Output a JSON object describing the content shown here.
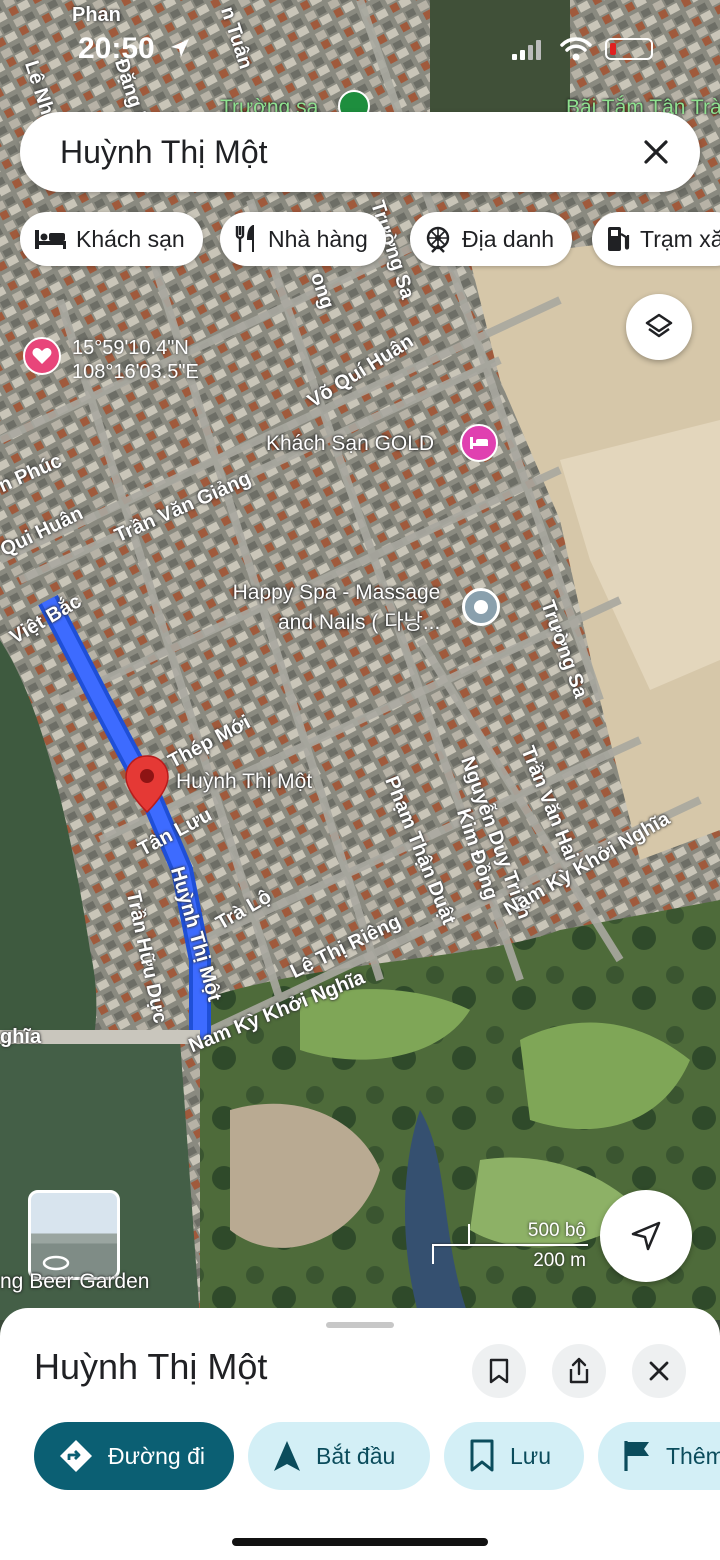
{
  "status_bar": {
    "time": "20:50"
  },
  "search": {
    "query": "Huỳnh Thị Một"
  },
  "chips": [
    {
      "label": "Khách sạn",
      "icon": "bed-icon"
    },
    {
      "label": "Nhà hàng",
      "icon": "restaurant-icon"
    },
    {
      "label": "Địa danh",
      "icon": "landmark-icon"
    },
    {
      "label": "Trạm xă",
      "icon": "gas-station-icon"
    }
  ],
  "map": {
    "coordinates": {
      "lat": "15°59'10.4\"N",
      "lng": "108°16'03.5\"E"
    },
    "pin_label": "Huỳnh Thị Một",
    "pois": {
      "hotel": "Khách Sạn GOLD",
      "spa_line1": "Happy Spa - Massage",
      "spa_line2": "and Nails ( 다낭...",
      "beer_garden": "ng Beer Garden",
      "top_poi": "Trường sa",
      "top_right_poi": "Bãi Tắm Tân Trà"
    },
    "roads": {
      "le_nhu_ho": "Lê Như Hổ",
      "phan": "Phan",
      "dang_hai": "Đặng Hải",
      "tuan": "n Tuân",
      "truong_sa_1": "Trường Sa",
      "ong": "ong",
      "vo_qui_huan_1": "Võ Quí Huân",
      "phuc": "n Phúc",
      "qui_huan": "Qui Huân",
      "tran_van_giang": "Trần Văn Giảng",
      "viet_bac": "Việt Bắc",
      "thep_moi": "Thép Mới",
      "tan_luu": "Tân Lưu",
      "huynh_thi_mot": "Huỳnh Thị Một",
      "tran_huu_duc": "Trần Hữu Dực",
      "tra_lo": "Trà Lộ",
      "le_thi_rieng": "Lê Thị Riêng",
      "nam_ky_khoi_nghia_1": "Nam Kỳ Khởi Nghĩa",
      "nam_ky_khoi_nghia_2": "Nam Kỳ Khởi Nghĩa",
      "nghia": "ghĩa",
      "pham_than_duat": "Phạm Thận Duật",
      "kim_dong": "Kim Đồng",
      "nguyen_duy_trinh": "Nguyễn Duy Trinh",
      "tran_van_hai": "Trần Văn Hai",
      "truong_sa_2": "Trường Sa",
      "nam_ky_right": "Nam Kỳ Khởi Nghĩa"
    },
    "scale": {
      "imperial": "500 bộ",
      "metric": "200 m"
    }
  },
  "sheet": {
    "title": "Huỳnh Thị Một",
    "actions": [
      {
        "label": "Đường đi",
        "icon": "directions-icon"
      },
      {
        "label": "Bắt đầu",
        "icon": "navigation-arrow-icon"
      },
      {
        "label": "Lưu",
        "icon": "bookmark-icon"
      },
      {
        "label": "Thêm",
        "icon": "flag-icon"
      }
    ]
  },
  "colors": {
    "route": "#1a57f2",
    "primary": "#0b5f73",
    "secondary": "#d3eff6",
    "pin": "#e53935",
    "hotel": "#e040b0"
  }
}
